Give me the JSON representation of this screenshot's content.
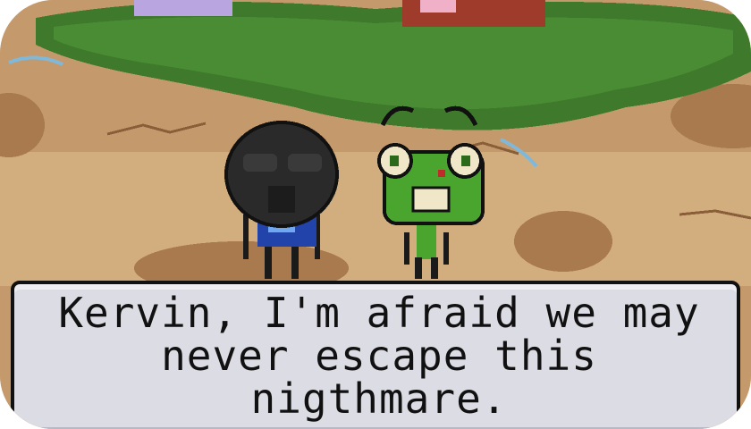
{
  "dialog": {
    "lines": [
      "Kervin, I'm afraid we may",
      "never escape this",
      "nigthmare."
    ]
  },
  "characters": [
    {
      "id": "dark-masked-creature",
      "colors": {
        "body": "#2a2a2a",
        "shirt": "#2244aa"
      }
    },
    {
      "id": "green-frog-creature",
      "colors": {
        "body": "#4aa52e",
        "eyes": "#f0e6c8"
      }
    }
  ],
  "colors": {
    "ground": "#c49a6c",
    "path": "#d8b88a",
    "bush": "#3f7a2c",
    "dialog_bg": "#dcdce4",
    "dialog_border": "#111111"
  }
}
